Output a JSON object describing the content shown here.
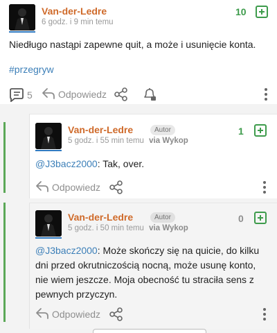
{
  "post": {
    "author": "Van-der-Ledre",
    "time": "6 godz. i 9 min temu",
    "score": "10",
    "text": "Niedługo nastąpi zapewne quit, a może i usunięcie konta.",
    "tag": "#przegryw",
    "comment_count": "5",
    "reply_label": "Odpowiedz"
  },
  "replies": [
    {
      "author": "Van-der-Ledre",
      "badge": "Autor",
      "time": "5 godz. i 55 min temu",
      "via": "via Wykop",
      "score": "1",
      "mention": "@J3bacz2000",
      "text": ": Tak, over.",
      "reply_label": "Odpowiedz"
    },
    {
      "author": "Van-der-Ledre",
      "badge": "Autor",
      "time": "5 godz. i 50 min temu",
      "via": "via Wykop",
      "score": "0",
      "mention": "@J3bacz2000",
      "text": ": Może skończy się na quicie, do kilku dni przed okrutniczością nocną, może usunę konto, nie wiem jeszcze. Moja obecność tu straciła sens z pewnych przyczyn.",
      "reply_label": "Odpowiedz"
    }
  ],
  "colors": {
    "author": "#cf6a2a",
    "positive_score": "#3d9b4b",
    "link": "#3c7fb8",
    "thread_bar": "#5ba857"
  },
  "icons": [
    "avatar",
    "plus-icon",
    "comment-icon",
    "reply-arrow-icon",
    "share-icon",
    "bell-icon",
    "more-icon"
  ]
}
